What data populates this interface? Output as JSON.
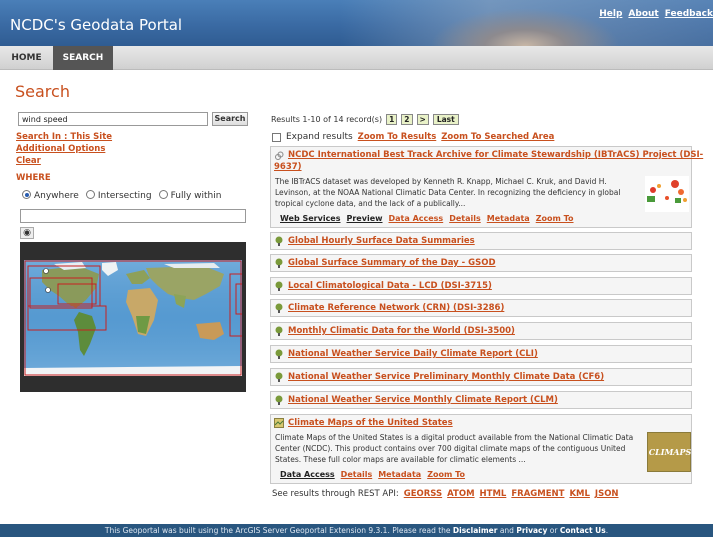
{
  "header": {
    "title": "NCDC's Geodata Portal",
    "links": [
      "Help",
      "About",
      "Feedback"
    ]
  },
  "nav": {
    "home": "HOME",
    "search": "SEARCH"
  },
  "page_title": "Search",
  "search": {
    "value": "wind speed",
    "button": "Search"
  },
  "left_links": {
    "search_in": "Search In : This Site",
    "additional": "Additional Options",
    "clear": "Clear"
  },
  "where": {
    "label": "WHERE",
    "options": [
      "Anywhere",
      "Intersecting",
      "Fully within"
    ],
    "selected": "Anywhere"
  },
  "results": {
    "summary": "Results 1-10 of 14 record(s)",
    "pages": [
      "1",
      "2",
      ">",
      "Last"
    ],
    "expand_label": "Expand results",
    "zoom_results": "Zoom To Results",
    "zoom_searched": "Zoom To Searched Area",
    "items": [
      {
        "title_l1": "NCDC International Best Track Archive for Climate Stewardship (IBTrACS) Project (DSI-",
        "title_l2": "9637)",
        "desc": [
          "The IBTrACS dataset was developed by Kenneth R. Knapp, Michael C. Kruk, and David H.",
          "Levinson, at the NOAA National Climatic Data Center. In recognizing the deficiency in global",
          "tropical cyclone data, and the lack of a publically..."
        ],
        "links": [
          "Web Services",
          "Preview",
          "Data Access",
          "Details",
          "Metadata",
          "Zoom To"
        ]
      },
      {
        "title": "Global Hourly Surface Data Summaries"
      },
      {
        "title": "Global Surface Summary of the Day - GSOD"
      },
      {
        "title": "Local Climatological Data - LCD (DSI-3715)"
      },
      {
        "title": "Climate Reference Network (CRN) (DSI-3286)"
      },
      {
        "title": "Monthly Climatic Data for the World (DSI-3500)"
      },
      {
        "title": "National Weather Service Daily Climate Report (CLI)"
      },
      {
        "title": "National Weather Service Preliminary Monthly Climate Data (CF6)"
      },
      {
        "title": "National Weather Service Monthly Climate Report (CLM)"
      },
      {
        "title": "Climate Maps of the United States",
        "desc": [
          "Climate Maps of the United States is a digital product available from the National Climatic Data",
          "Center (NCDC). This product contains over 700 digital climate maps of the contiguous United",
          "States. These full color maps are available for climatic elements ..."
        ],
        "links": [
          "Data Access",
          "Details",
          "Metadata",
          "Zoom To"
        ],
        "thumb_label": "CLIMAPS"
      }
    ]
  },
  "rest": {
    "label": "See results through REST API:",
    "formats": [
      "GEORSS",
      "ATOM",
      "HTML",
      "FRAGMENT",
      "KML",
      "JSON"
    ]
  },
  "footer": {
    "pre": "This Geoportal was built using the ArcGIS Server Geoportal Extension 9.3.1. Please read the",
    "disclaimer": "Disclaimer",
    "and": "and",
    "privacy": "Privacy",
    "or": "or",
    "contact": "Contact Us",
    "end": "."
  },
  "colors": {
    "accent": "#c8501e",
    "header": "#3a6aa3",
    "footer": "#29567f",
    "page_button": "#e9f2c8"
  }
}
